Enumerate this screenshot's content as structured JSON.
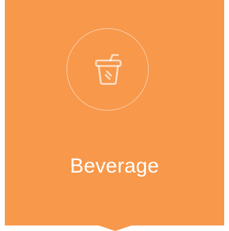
{
  "category": {
    "label": "Beverage",
    "icon": "beverage-cup-icon",
    "colors": {
      "tile_background": "#F7984B",
      "foreground": "#FFFFFF"
    }
  }
}
